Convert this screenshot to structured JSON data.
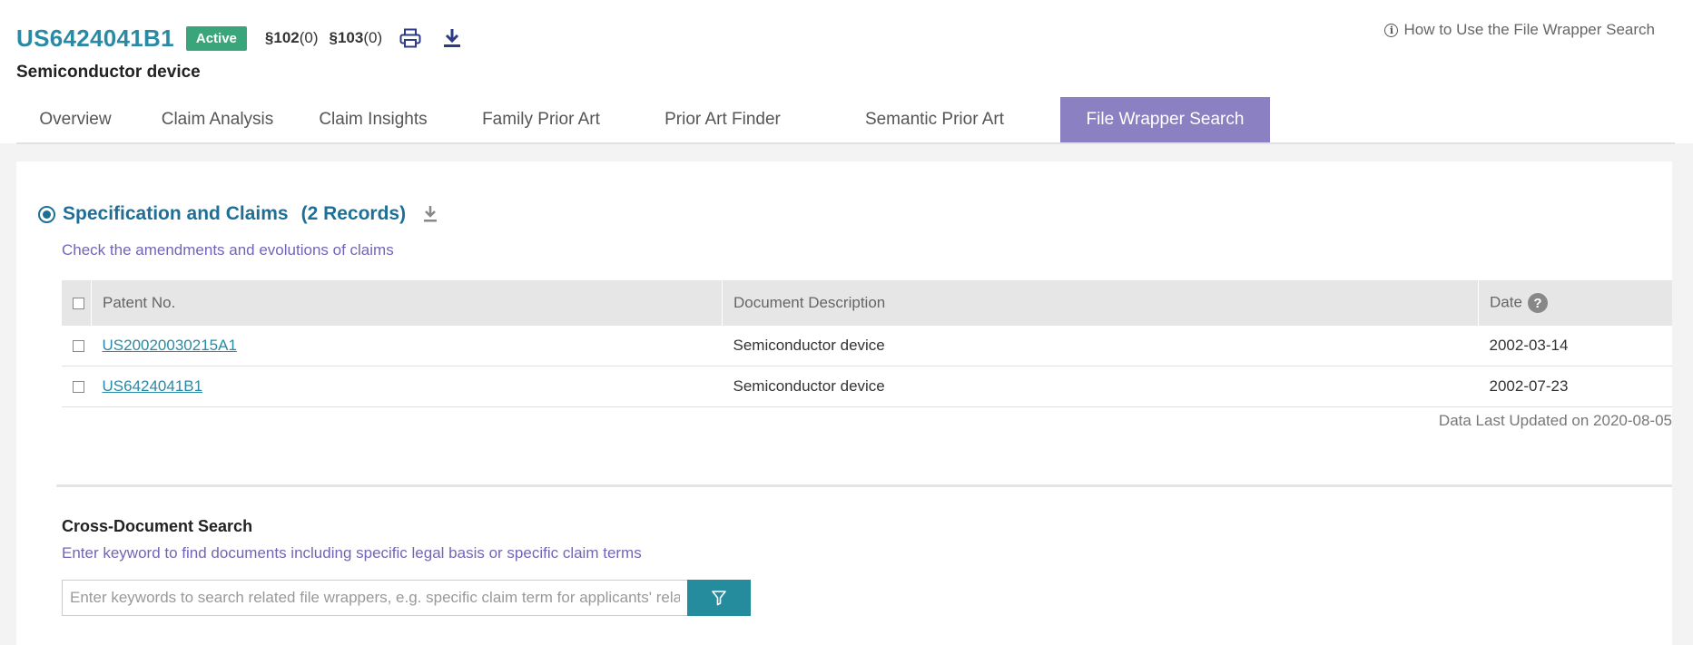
{
  "header": {
    "patent_number": "US6424041B1",
    "status": "Active",
    "sec102_label": "§102",
    "sec102_count": "(0)",
    "sec103_label": "§103",
    "sec103_count": "(0)",
    "title": "Semiconductor device",
    "help_link": "How to Use the File Wrapper Search",
    "icons": {
      "print": "printer-icon",
      "download": "download-icon",
      "help": "info-icon"
    }
  },
  "tabs": [
    {
      "label": "Overview"
    },
    {
      "label": "Claim Analysis"
    },
    {
      "label": "Claim Insights"
    },
    {
      "label": "Family Prior Art"
    },
    {
      "label": "Prior Art Finder"
    },
    {
      "label": "Semantic Prior Art"
    },
    {
      "label": "File Wrapper Search",
      "active": true
    }
  ],
  "spec_section": {
    "title": "Specification and Claims",
    "count": "(2 Records)",
    "subtitle": "Check the amendments and evolutions of claims",
    "table": {
      "headers": {
        "patent": "Patent No.",
        "description": "Document Description",
        "date": "Date"
      },
      "rows": [
        {
          "patent": "US20020030215A1",
          "description": "Semiconductor device",
          "date": "2002-03-14"
        },
        {
          "patent": "US6424041B1",
          "description": "Semiconductor device",
          "date": "2002-07-23"
        }
      ]
    },
    "updated": "Data Last Updated on 2020-08-05"
  },
  "cross_search": {
    "title": "Cross-Document Search",
    "subtitle": "Enter keyword to find documents including specific legal basis or specific claim terms",
    "placeholder": "Enter keywords to search related file wrappers, e.g. specific claim term for applicants' related interpretation"
  },
  "colors": {
    "accent": "#2a8aa3",
    "active_tab": "#8a80c2",
    "badge": "#3aa57a",
    "filter_button": "#248c9c",
    "subtitle": "#7464b6"
  }
}
